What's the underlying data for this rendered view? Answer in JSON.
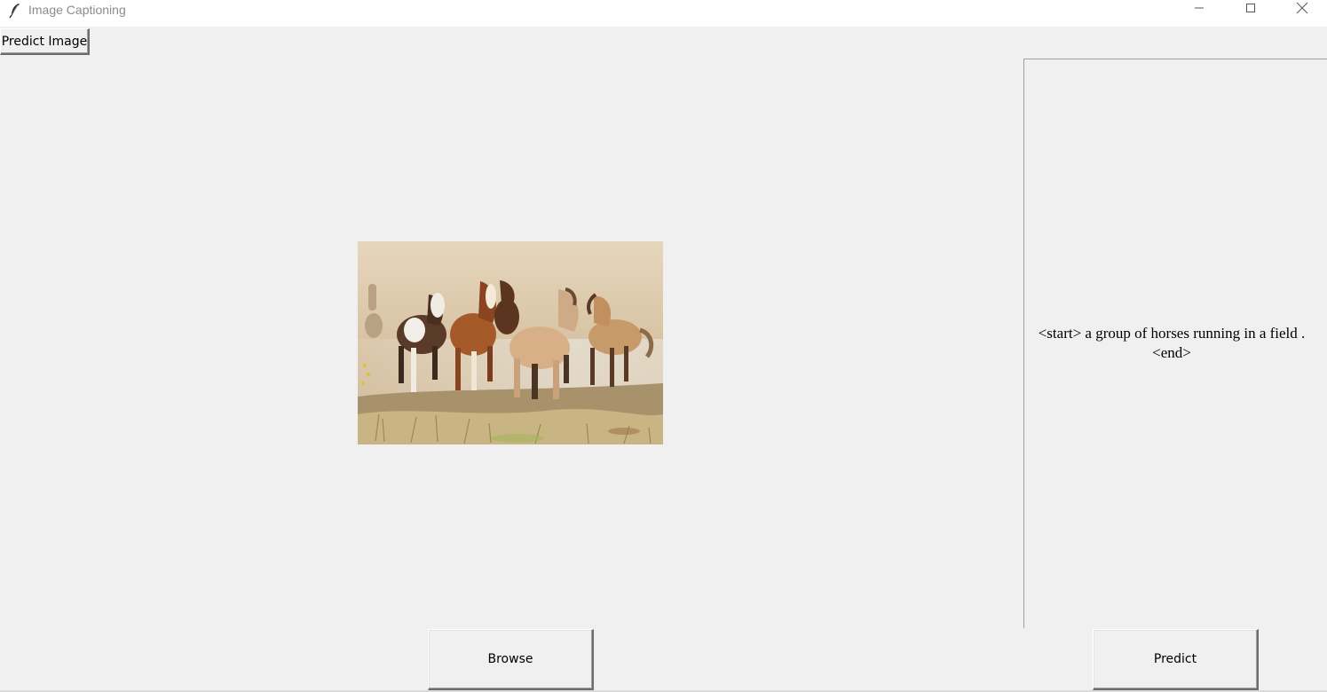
{
  "window": {
    "title": "Image Captioning",
    "icon": "feather-icon",
    "controls": [
      "minimize-icon",
      "maximize-icon",
      "close-icon"
    ]
  },
  "toolbar": {
    "predict_image_label": "Predict Image"
  },
  "image_panel": {
    "image_subject": "photo-horses-running"
  },
  "caption": {
    "text": "<start> a group of horses running in a field .\n<end>"
  },
  "buttons": {
    "browse_label": "Browse",
    "predict_label": "Predict"
  }
}
